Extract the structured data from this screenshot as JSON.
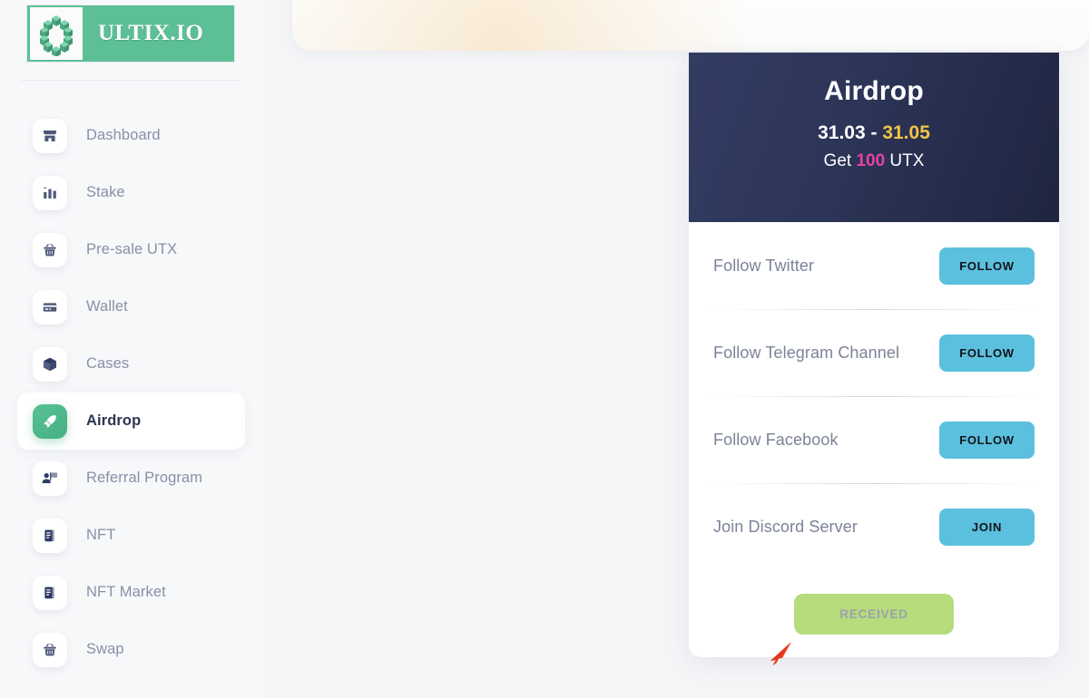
{
  "brand": {
    "name": "ULTIX.IO",
    "logo_icon": "hexagon-cubes-icon",
    "accent_green": "#5cbf96"
  },
  "sidebar": {
    "items": [
      {
        "label": "Dashboard",
        "icon": "store-icon",
        "active": false
      },
      {
        "label": "Stake",
        "icon": "bar-chart-icon",
        "active": false
      },
      {
        "label": "Pre-sale UTX",
        "icon": "basket-icon",
        "active": false
      },
      {
        "label": "Wallet",
        "icon": "credit-card-icon",
        "active": false
      },
      {
        "label": "Cases",
        "icon": "box-icon",
        "active": false
      },
      {
        "label": "Airdrop",
        "icon": "rocket-icon",
        "active": true
      },
      {
        "label": "Referral Program",
        "icon": "user-flag-icon",
        "active": false
      },
      {
        "label": "NFT",
        "icon": "document-icon",
        "active": false
      },
      {
        "label": "NFT Market",
        "icon": "document-icon",
        "active": false
      },
      {
        "label": "Swap",
        "icon": "basket-icon",
        "active": false
      }
    ]
  },
  "airdrop_card": {
    "title": "Airdrop",
    "date_start": "31.03",
    "date_separator": " - ",
    "date_end": "31.05",
    "amount_prefix": "Get ",
    "amount_value": "100",
    "amount_suffix": " UTX",
    "date_end_color": "#f0c446",
    "amount_color": "#e5439e",
    "header_bg": "#2c3457",
    "tasks": [
      {
        "label": "Follow Twitter",
        "action_label": "FOLLOW"
      },
      {
        "label": "Follow Telegram Channel",
        "action_label": "FOLLOW"
      },
      {
        "label": "Follow Facebook",
        "action_label": "FOLLOW"
      },
      {
        "label": "Join Discord Server",
        "action_label": "JOIN"
      }
    ],
    "task_button_color": "#5bc0de",
    "footer": {
      "received_label": "RECEIVED",
      "received_color": "#b6dc7c",
      "received_text_color": "#9aa2ad",
      "disabled": true
    }
  },
  "cursor": {
    "icon": "arrow-cursor-icon",
    "color": "#ee3d23"
  }
}
